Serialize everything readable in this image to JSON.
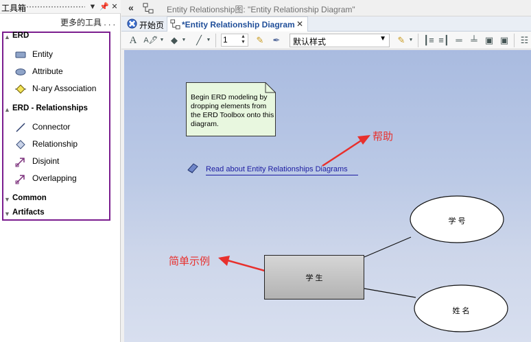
{
  "toolbox": {
    "title": "工具箱",
    "more_tools": "更多的工具 . . .",
    "groups": [
      {
        "name": "ERD",
        "items": [
          "Entity",
          "Attribute",
          "N-ary Association"
        ]
      },
      {
        "name": "ERD - Relationships",
        "items": [
          "Connector",
          "Relationship",
          "Disjoint",
          "Overlapping"
        ]
      },
      {
        "name": "Common"
      },
      {
        "name": "Artifacts"
      }
    ]
  },
  "header": {
    "diagram_title": "Entity Relationship图: \"Entity Relationship Diagram\""
  },
  "tabs": {
    "start": "开始页",
    "diagram": "*Entity Relationship Diagram",
    "close": "✕"
  },
  "toolbar": {
    "line_width": "1",
    "style_preset": "默认样式"
  },
  "canvas": {
    "note_text": "Begin ERD modeling by dropping elements from the ERD Toolbox onto this diagram.",
    "help_link": "Read about Entity Relationships Diagrams",
    "entity": "学 生",
    "attributes": [
      "学 号",
      "姓 名"
    ],
    "annotations": {
      "help": "帮助",
      "example": "简单示例"
    }
  },
  "colors": {
    "annotation_red": "#e8302d",
    "highlight_frame": "#7a1c8e",
    "tab_text": "#1f4e99",
    "link": "#1a1aa0"
  }
}
